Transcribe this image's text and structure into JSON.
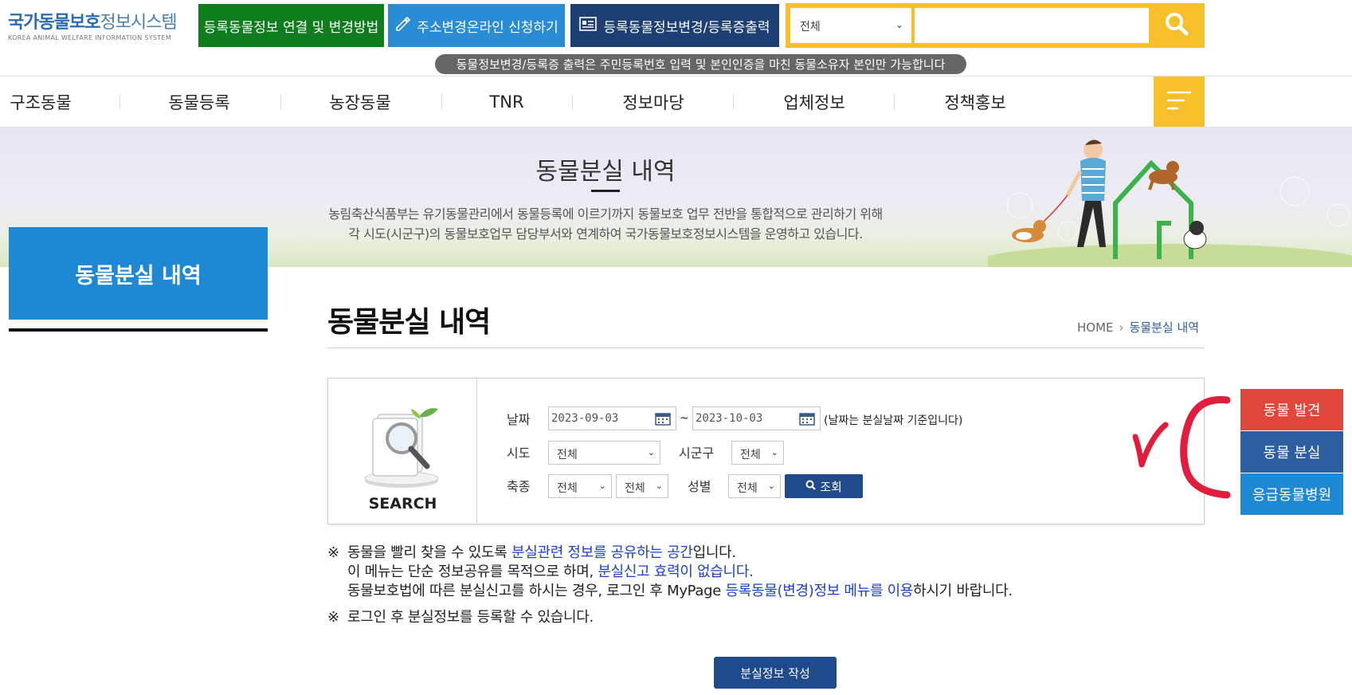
{
  "header": {
    "logo_title_bold": "국가동물보호",
    "logo_title_light": "정보시스템",
    "logo_subtitle": "KOREA ANIMAL WELFARE INFORMATION SYSTEM",
    "btn_link_change": "등록동물정보 연결 및 변경방법",
    "btn_address_change": "주소변경온라인 신청하기",
    "btn_info_print": "등록동물정보변경/등록증출력",
    "search_select_value": "전체",
    "search_placeholder": "",
    "notice_pill": "동물정보변경/등록증 출력은 주민등록번호 입력 및 본인인증을 마친 동물소유자 본인만 가능합니다"
  },
  "nav": {
    "items": [
      {
        "label": "구조동물"
      },
      {
        "label": "동물등록"
      },
      {
        "label": "농장동물"
      },
      {
        "label": "TNR"
      },
      {
        "label": "정보마당"
      },
      {
        "label": "업체정보"
      },
      {
        "label": "정책홍보"
      }
    ]
  },
  "hero": {
    "title": "동물분실 내역",
    "desc_line1": "농림축산식품부는 유기동물관리에서 동물등록에 이르기까지 동물보호 업무 전반을 통합적으로 관리하기 위해",
    "desc_line2": "각 시도(시군구)의 동물보호업무 담당부서와 연계하여 국가동물보호정보시스템을 운영하고 있습니다."
  },
  "sidebar": {
    "title": "동물분실 내역"
  },
  "main": {
    "page_title": "동물분실 내역",
    "breadcrumb": {
      "home": "HOME",
      "current": "동물분실 내역"
    }
  },
  "search_form": {
    "side_label": "SEARCH",
    "date_label": "날짜",
    "date_from": "2023-09-03",
    "date_tilde": "~",
    "date_to": "2023-10-03",
    "date_note": "(날짜는 분실날짜 기준입니다)",
    "sido_label": "시도",
    "sido_value": "전체",
    "sigungu_label": "시군구",
    "sigungu_value": "전체",
    "species_label": "축종",
    "species_value": "전체",
    "breed_value": "전체",
    "sex_label": "성별",
    "sex_value": "전체",
    "query_button": "조회"
  },
  "notices": {
    "mark": "※",
    "line1_a": "동물을 빨리 찾을 수 있도록 ",
    "line1_hl": "분실관련 정보를 공유하는 공간",
    "line1_b": "입니다.",
    "line2_a": "이 메뉴는 단순 정보공유를 목적으로 하며, ",
    "line2_hl": "분실신고 효력이 없습니다.",
    "line3_a": "동물보호법에 따른 분실신고를 하시는 경우, 로그인 후 MyPage ",
    "line3_hl": "등록동물(변경)정보 메뉴를 이용",
    "line3_b": "하시기 바랍니다.",
    "line4": "로그인 후 분실정보를 등록할 수 있습니다."
  },
  "write_button": "분실정보 작성",
  "quick_menu": {
    "found": "동물 발견",
    "lost": "동물 분실",
    "hospital": "응급동물병원"
  },
  "colors": {
    "green": "#0f7d1e",
    "blue": "#2b8cd6",
    "navy": "#1e3f73",
    "yellow": "#f7c02b",
    "sidebar_blue": "#1e88d4",
    "button_navy": "#1f4a8c",
    "red": "#e0463a",
    "highlight": "#1a3fd1",
    "annotation_red": "#e41c3c"
  }
}
